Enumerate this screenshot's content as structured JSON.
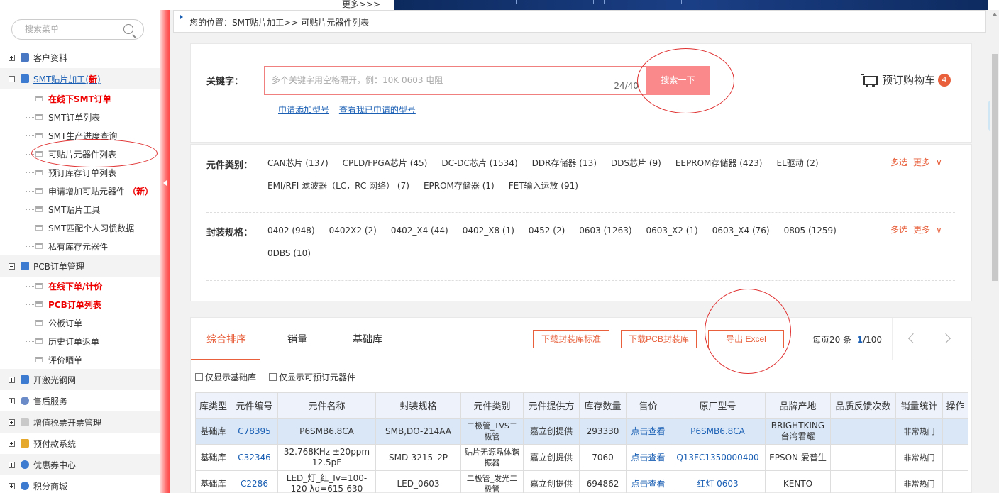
{
  "top": {
    "more": "更多>>>"
  },
  "sidebar": {
    "search_placeholder": "搜索菜单",
    "groups": [
      {
        "label": "客户资料"
      },
      {
        "label": "SMT贴片加工",
        "new": "新",
        "sub": [
          {
            "label": "在线下SMT订单",
            "red": true
          },
          {
            "label": "SMT订单列表"
          },
          {
            "label": "SMT生产进度查询"
          },
          {
            "label": "可贴片元器件列表"
          },
          {
            "label": "预订库存订单列表"
          },
          {
            "label": "申请增加可贴元器件",
            "new": "（新）"
          },
          {
            "label": "SMT贴片工具"
          },
          {
            "label": "SMT匹配个人习惯数据"
          },
          {
            "label": "私有库存元器件"
          }
        ]
      },
      {
        "label": "PCB订单管理",
        "sub": [
          {
            "label": "在线下单/计价",
            "red": true
          },
          {
            "label": "PCB订单列表",
            "red": true
          },
          {
            "label": "公板订单"
          },
          {
            "label": "历史订单返单"
          },
          {
            "label": "评价晒单"
          }
        ]
      },
      {
        "label": "开激光钢网"
      },
      {
        "label": "售后服务"
      },
      {
        "label": "增值税票开票管理"
      },
      {
        "label": "预付款系统"
      },
      {
        "label": "优惠券中心"
      },
      {
        "label": "积分商城"
      }
    ]
  },
  "breadcrumb": "您的位置：SMT贴片加工>> 可贴片元器件列表",
  "search": {
    "keyword_label": "关键字：",
    "placeholder": "多个关键字用空格隔开，例：10K 0603 电阻",
    "counter": "24/40",
    "button": "搜索一下",
    "link_apply": "申请添加型号",
    "link_view": "查看我已申请的型号",
    "cart_label": "预订购物车",
    "cart_count": "4"
  },
  "filters": {
    "category_label": "元件类别：",
    "categories": [
      "CAN芯片 (137)",
      "CPLD/FPGA芯片 (45)",
      "DC-DC芯片 (1534)",
      "DDR存储器 (13)",
      "DDS芯片 (9)",
      "EEPROM存储器 (423)",
      "EL驱动 (2)",
      "EMI/RFI 滤波器（LC，RC 网络） (7)",
      "EPROM存储器 (1)",
      "FET输入运放 (91)"
    ],
    "package_label": "封装规格：",
    "packages": [
      "0402 (948)",
      "0402X2 (2)",
      "0402_X4 (44)",
      "0402_X8 (1)",
      "0452 (2)",
      "0603 (1263)",
      "0603_X2 (1)",
      "0603_X4 (76)",
      "0805 (1259)",
      "0DBS (10)"
    ],
    "multi": "多选",
    "more": "更多"
  },
  "list": {
    "tabs": [
      "综合排序",
      "销量",
      "基础库"
    ],
    "btn_download_std": "下载封装库标准",
    "btn_download_pcb": "下载PCB封装库",
    "btn_export": "导出 Excel",
    "per_page": "每页20 条",
    "page_current": "1",
    "page_total": "/100",
    "check_basic": "仅显示基础库",
    "check_preorder": "仅显示可预订元器件",
    "headers": [
      "库类型",
      "元件编号",
      "元件名称",
      "封装规格",
      "元件类别",
      "元件提供方",
      "库存数量",
      "售价",
      "原厂型号",
      "品牌产地",
      "品质反馈次数",
      "销量统计",
      "操作"
    ],
    "rows": [
      [
        "基础库",
        "C78395",
        "P6SMB6.8CA",
        "SMB,DO-214AA",
        "二极管_TVS二极管",
        "嘉立创提供",
        "293330",
        "点击查看",
        "P6SMB6.8CA",
        "BRIGHTKING 台湾君耀",
        "",
        "非常热门",
        ""
      ],
      [
        "基础库",
        "C32346",
        "32.768KHz ±20ppm 12.5pF",
        "SMD-3215_2P",
        "贴片无源晶体谐振器",
        "嘉立创提供",
        "7060",
        "点击查看",
        "Q13FC1350000400",
        "EPSON 爱普生",
        "",
        "非常热门",
        ""
      ],
      [
        "基础库",
        "C2286",
        "LED_灯_红_Iv=100-120 λd=615-630",
        "LED_0603",
        "二极管_发光二极管",
        "嘉立创提供",
        "694862",
        "点击查看",
        "红灯 0603",
        "KENTO",
        "",
        "非常热门",
        ""
      ]
    ]
  }
}
